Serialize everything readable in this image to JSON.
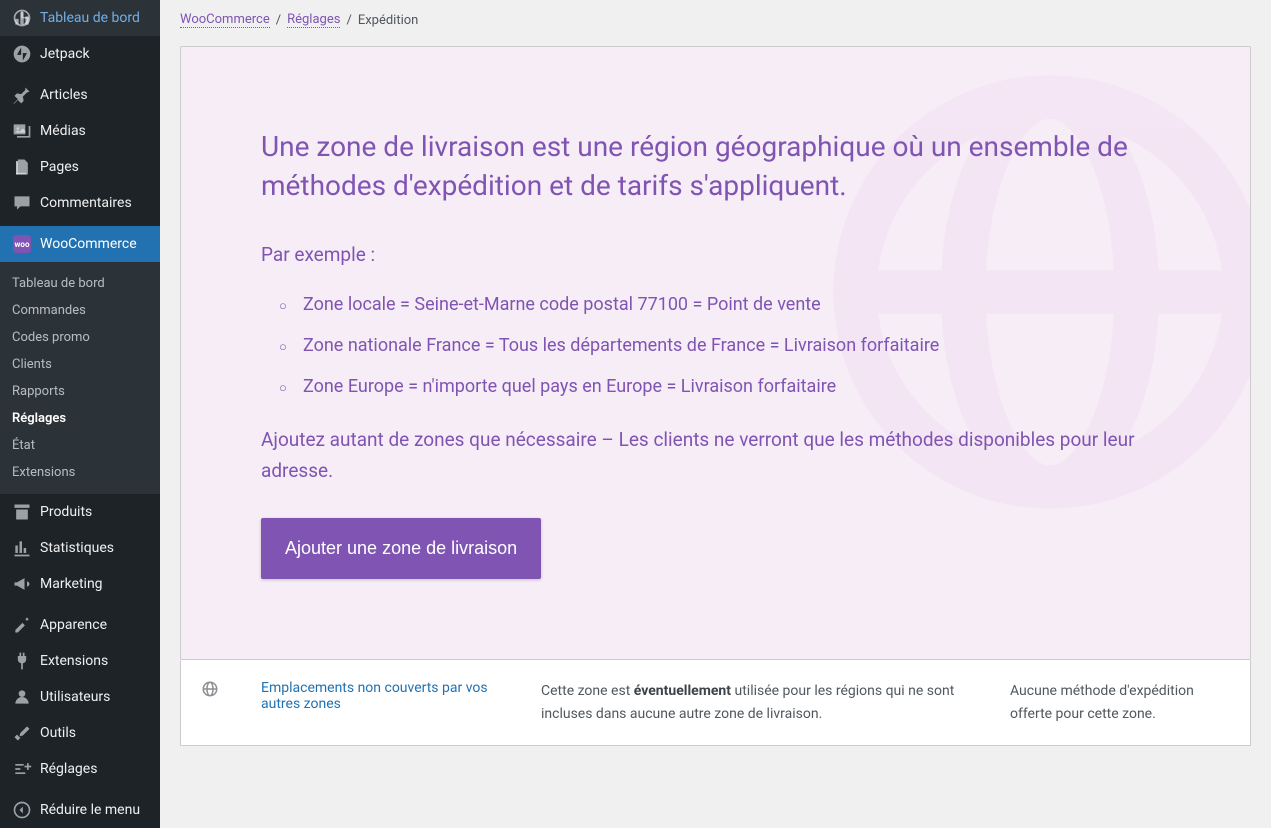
{
  "sidebar": {
    "items": [
      {
        "label": "Tableau de bord",
        "icon": "dashboard"
      },
      {
        "label": "Jetpack",
        "icon": "jetpack"
      },
      {
        "label": "Articles",
        "icon": "pin"
      },
      {
        "label": "Médias",
        "icon": "media"
      },
      {
        "label": "Pages",
        "icon": "pages"
      },
      {
        "label": "Commentaires",
        "icon": "comments"
      },
      {
        "label": "WooCommerce",
        "icon": "woo"
      },
      {
        "label": "Produits",
        "icon": "archive"
      },
      {
        "label": "Statistiques",
        "icon": "stats"
      },
      {
        "label": "Marketing",
        "icon": "megaphone"
      },
      {
        "label": "Apparence",
        "icon": "appearance"
      },
      {
        "label": "Extensions",
        "icon": "plugins"
      },
      {
        "label": "Utilisateurs",
        "icon": "users"
      },
      {
        "label": "Outils",
        "icon": "tools"
      },
      {
        "label": "Réglages",
        "icon": "settings"
      },
      {
        "label": "Réduire le menu",
        "icon": "collapse"
      }
    ]
  },
  "submenu": {
    "items": [
      {
        "label": "Tableau de bord"
      },
      {
        "label": "Commandes"
      },
      {
        "label": "Codes promo"
      },
      {
        "label": "Clients"
      },
      {
        "label": "Rapports"
      },
      {
        "label": "Réglages"
      },
      {
        "label": "État"
      },
      {
        "label": "Extensions"
      }
    ]
  },
  "breadcrumb": {
    "items": [
      {
        "label": "WooCommerce"
      },
      {
        "label": "Réglages"
      },
      {
        "label": "Expédition"
      }
    ]
  },
  "info": {
    "heading": "Une zone de livraison est une région géographique où un ensemble de méthodes d'expédition et de tarifs s'appliquent.",
    "example_label": "Par exemple :",
    "examples": [
      "Zone locale = Seine-et-Marne code postal 77100 = Point de vente",
      "Zone nationale France = Tous les départements de France = Livraison forfaitaire",
      "Zone Europe = n'importe quel pays en Europe = Livraison forfaitaire"
    ],
    "paragraph": "Ajoutez autant de zones que nécessaire – Les clients ne verront que les méthodes disponibles pour leur adresse.",
    "cta_label": "Ajouter une zone de livraison"
  },
  "zone_row": {
    "name": "Emplacements non couverts par vos autres zones",
    "desc_prefix": "Cette zone est ",
    "desc_strong": "éventuellement",
    "desc_suffix": " utilisée pour les régions qui ne sont incluses dans aucune autre zone de livraison.",
    "method": "Aucune méthode d'expédition offerte pour cette zone."
  }
}
